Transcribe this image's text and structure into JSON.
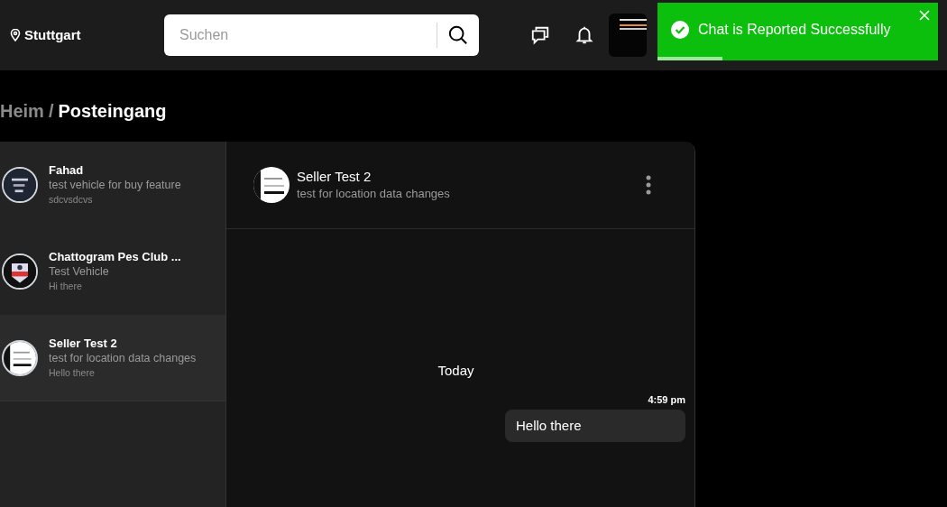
{
  "header": {
    "location": "Stuttgart",
    "search": {
      "placeholder": "Suchen"
    }
  },
  "toast": {
    "message": "Chat is Reported Successfully",
    "level": 0.23
  },
  "breadcrumb_separator": "/",
  "breadcrumb": [
    {
      "label": "Heim",
      "current": false
    },
    {
      "label": "Posteingang",
      "current": true
    }
  ],
  "conversations": [
    {
      "name": "Fahad",
      "subject": "test vehicle for buy feature",
      "last_message": "sdcvsdcvs",
      "selected": false
    },
    {
      "name": "Chattogram Pes Club ...",
      "subject": "Test Vehicle",
      "last_message": "Hi there",
      "selected": false
    },
    {
      "name": "Seller Test 2",
      "subject": "test for location data changes",
      "last_message": "Hello there",
      "selected": true
    }
  ],
  "chat": {
    "name": "Seller Test 2",
    "subject": "test for location data changes",
    "day": "Today",
    "messages": [
      {
        "time": "4:59 pm",
        "text": "Hello there"
      }
    ]
  }
}
